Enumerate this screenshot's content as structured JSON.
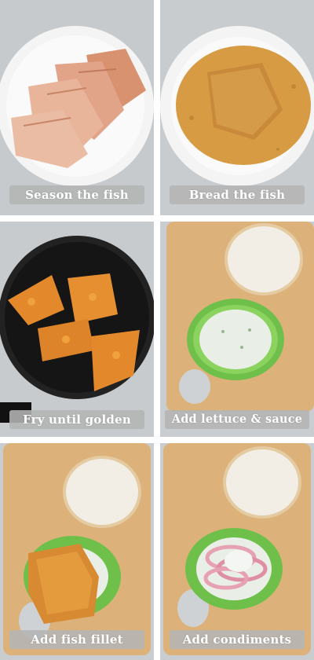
{
  "steps": [
    {
      "label": "Season the fish"
    },
    {
      "label": "Bread the fish"
    },
    {
      "label": "Fry until golden"
    },
    {
      "label": "Add lettuce & sauce"
    },
    {
      "label": "Add fish fillet"
    },
    {
      "label": "Add condiments"
    }
  ],
  "colors": {
    "countertop": "#c9cdd0",
    "plate": "#f4f4f4",
    "raw_fish": "#e8b59b",
    "breading": "#d79b43",
    "pan": "#1b1b1b",
    "fried_fish": "#e3892c",
    "board": "#dcb27a",
    "bun": "#f2eee6",
    "lettuce": "#6fc04a",
    "sauce": "#e9efe6",
    "onion": "#e6a1b3",
    "caption_bg": "#b4b4b4"
  }
}
